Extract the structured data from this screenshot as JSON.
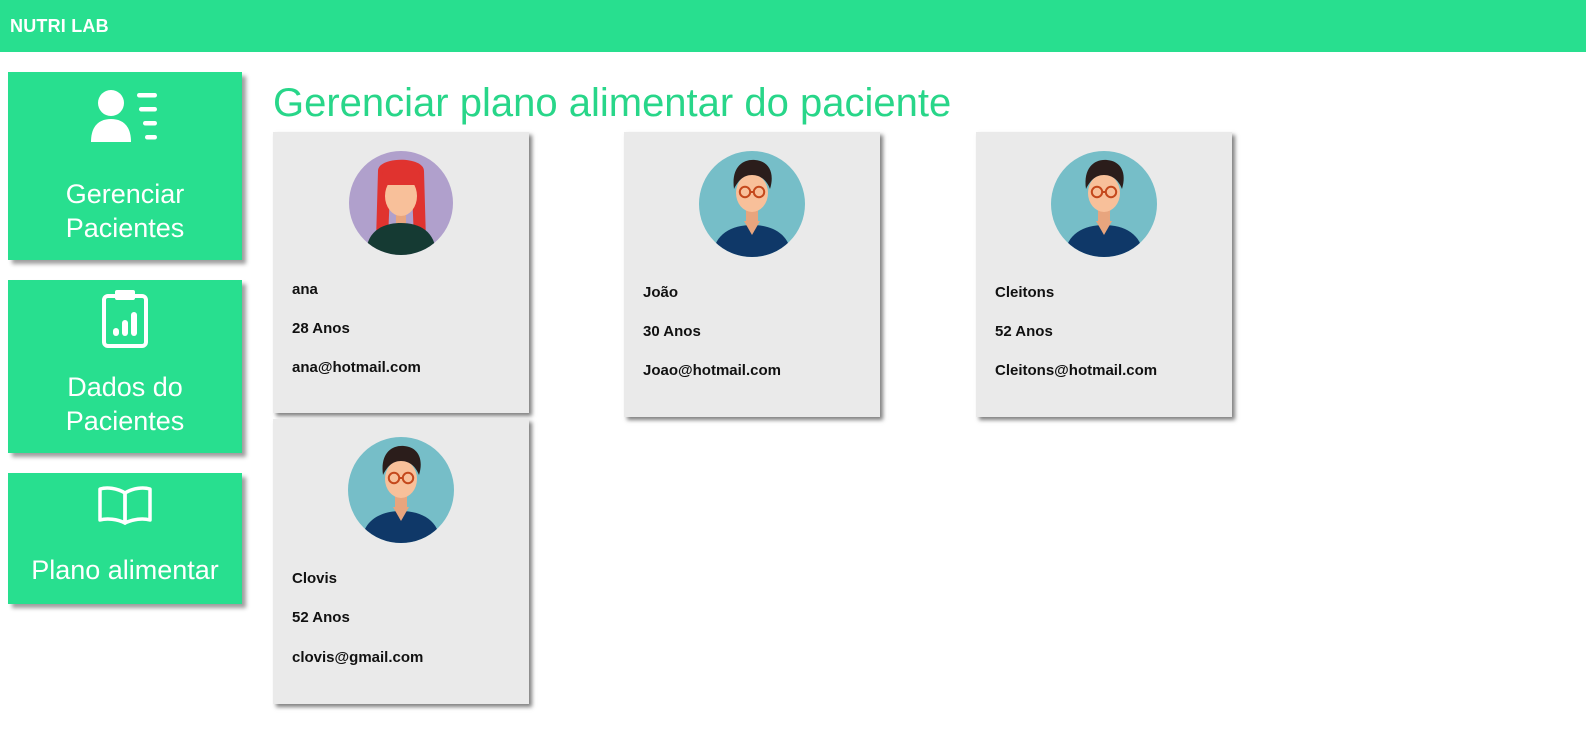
{
  "app": {
    "brand": "NUTRI LAB",
    "colors": {
      "accent": "#28df8f",
      "title": "#28d689",
      "card_bg": "#eaeaea"
    }
  },
  "sidebar": {
    "items": [
      {
        "label": "Gerenciar\nPacientes",
        "icon": "user-list-icon"
      },
      {
        "label": "Dados do\nPacientes",
        "icon": "clipboard-chart-icon"
      },
      {
        "label": "Plano alimentar",
        "icon": "open-book-icon"
      }
    ]
  },
  "main": {
    "title": "Gerenciar plano alimentar do paciente",
    "patients": [
      {
        "name": "ana",
        "age": "28 Anos",
        "email": "ana@hotmail.com",
        "avatar": "female-avatar-icon"
      },
      {
        "name": "João",
        "age": "30 Anos",
        "email": "Joao@hotmail.com",
        "avatar": "male-avatar-icon"
      },
      {
        "name": "Cleitons",
        "age": "52 Anos",
        "email": "Cleitons@hotmail.com",
        "avatar": "male-avatar-icon"
      },
      {
        "name": "Clovis",
        "age": "52 Anos",
        "email": "clovis@gmail.com",
        "avatar": "male-avatar-icon"
      }
    ]
  }
}
